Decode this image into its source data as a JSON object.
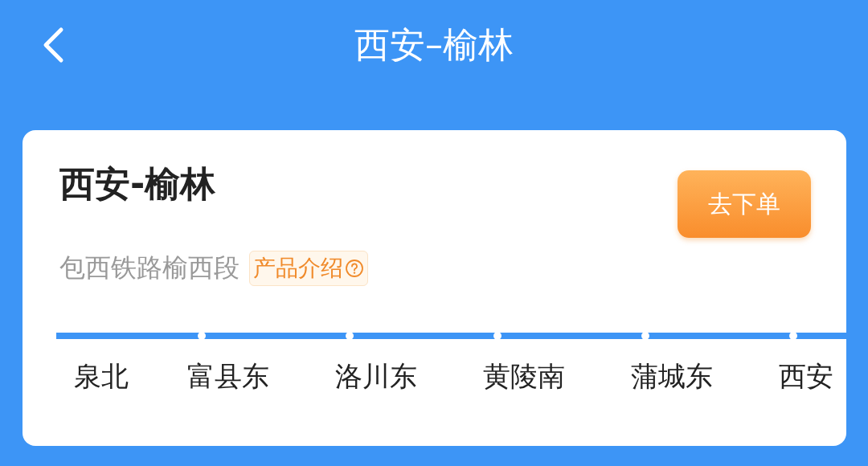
{
  "header": {
    "title": "西安–榆林"
  },
  "card": {
    "title": "西安-榆林",
    "order_button": "去下单",
    "route": "包西铁路榆西段",
    "tag": "产品介绍",
    "stations": [
      "泉北",
      "富县东",
      "洛川东",
      "黄陵南",
      "蒲城东",
      "西安"
    ]
  }
}
